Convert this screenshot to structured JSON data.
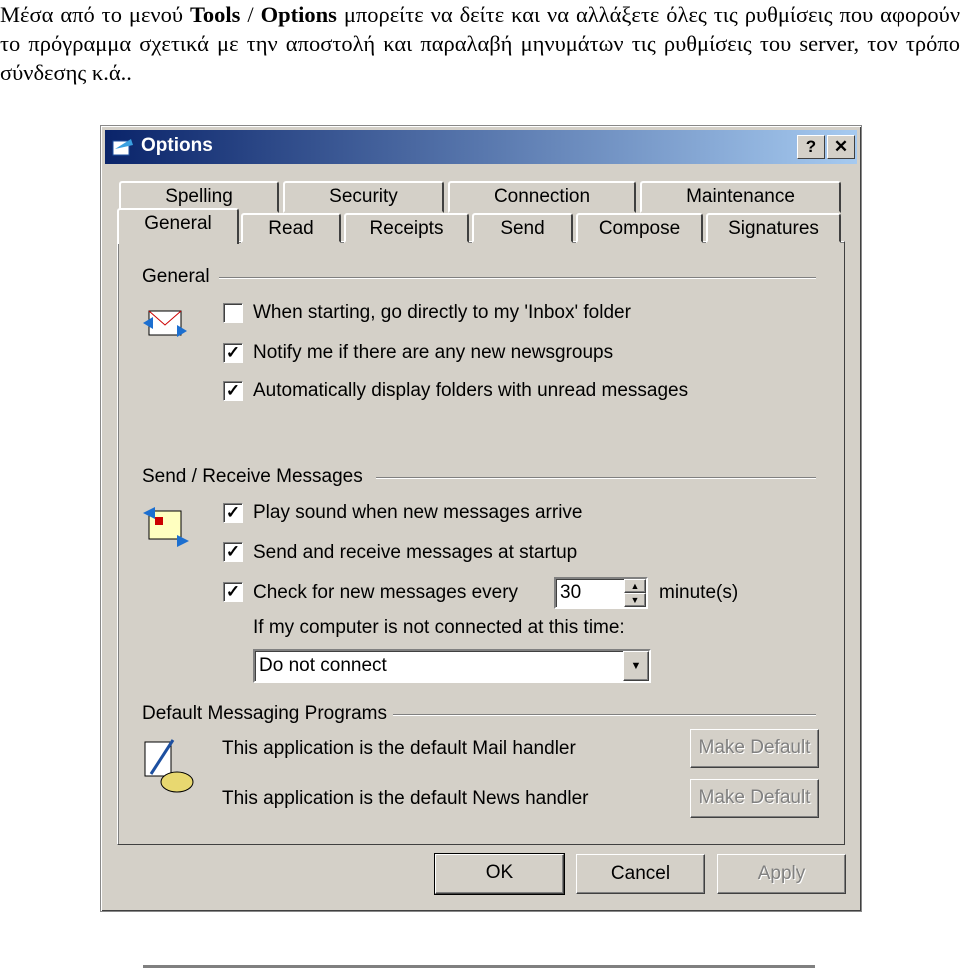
{
  "document": {
    "intro_before": "Μέσα από το μενού ",
    "menu_tools": "Tools",
    "sep": " / ",
    "menu_options": "Options",
    "intro_after": " μπορείτε να δείτε και να αλλάξετε όλες τις ρυθμίσεις που αφορούν το πρόγραμμα σχετικά με την αποστολή και παραλαβή μηνυμάτων τις ρυθμίσεις του server, τον τρόπο σύνδεσης κ.ά.."
  },
  "dialog": {
    "title": "Options",
    "help": "?",
    "close": "✕",
    "tabs_row1": [
      "Spelling",
      "Security",
      "Connection",
      "Maintenance"
    ],
    "tabs_row2": [
      "General",
      "Read",
      "Receipts",
      "Send",
      "Compose",
      "Signatures"
    ],
    "active_tab": "General",
    "general": {
      "heading": "General",
      "options": [
        {
          "label": "When starting, go directly to my 'Inbox' folder",
          "checked": false
        },
        {
          "label": "Notify me if there are any new newsgroups",
          "checked": true
        },
        {
          "label": "Automatically display folders with unread messages",
          "checked": true
        }
      ]
    },
    "send_receive": {
      "heading": "Send / Receive Messages",
      "options": [
        {
          "label": "Play sound when new messages arrive",
          "checked": true
        },
        {
          "label": "Send and receive messages at startup",
          "checked": true
        },
        {
          "label": "Check for new messages every",
          "checked": true
        }
      ],
      "interval": "30",
      "interval_unit": "minute(s)",
      "not_connected_label": "If my computer is not connected at this time:",
      "not_connected_value": "Do not connect"
    },
    "default_programs": {
      "heading": "Default Messaging Programs",
      "mail_text": "This application is the default Mail handler",
      "news_text": "This application is the default News handler",
      "make_default": "Make Default"
    },
    "buttons": {
      "ok": "OK",
      "cancel": "Cancel",
      "apply": "Apply"
    }
  }
}
